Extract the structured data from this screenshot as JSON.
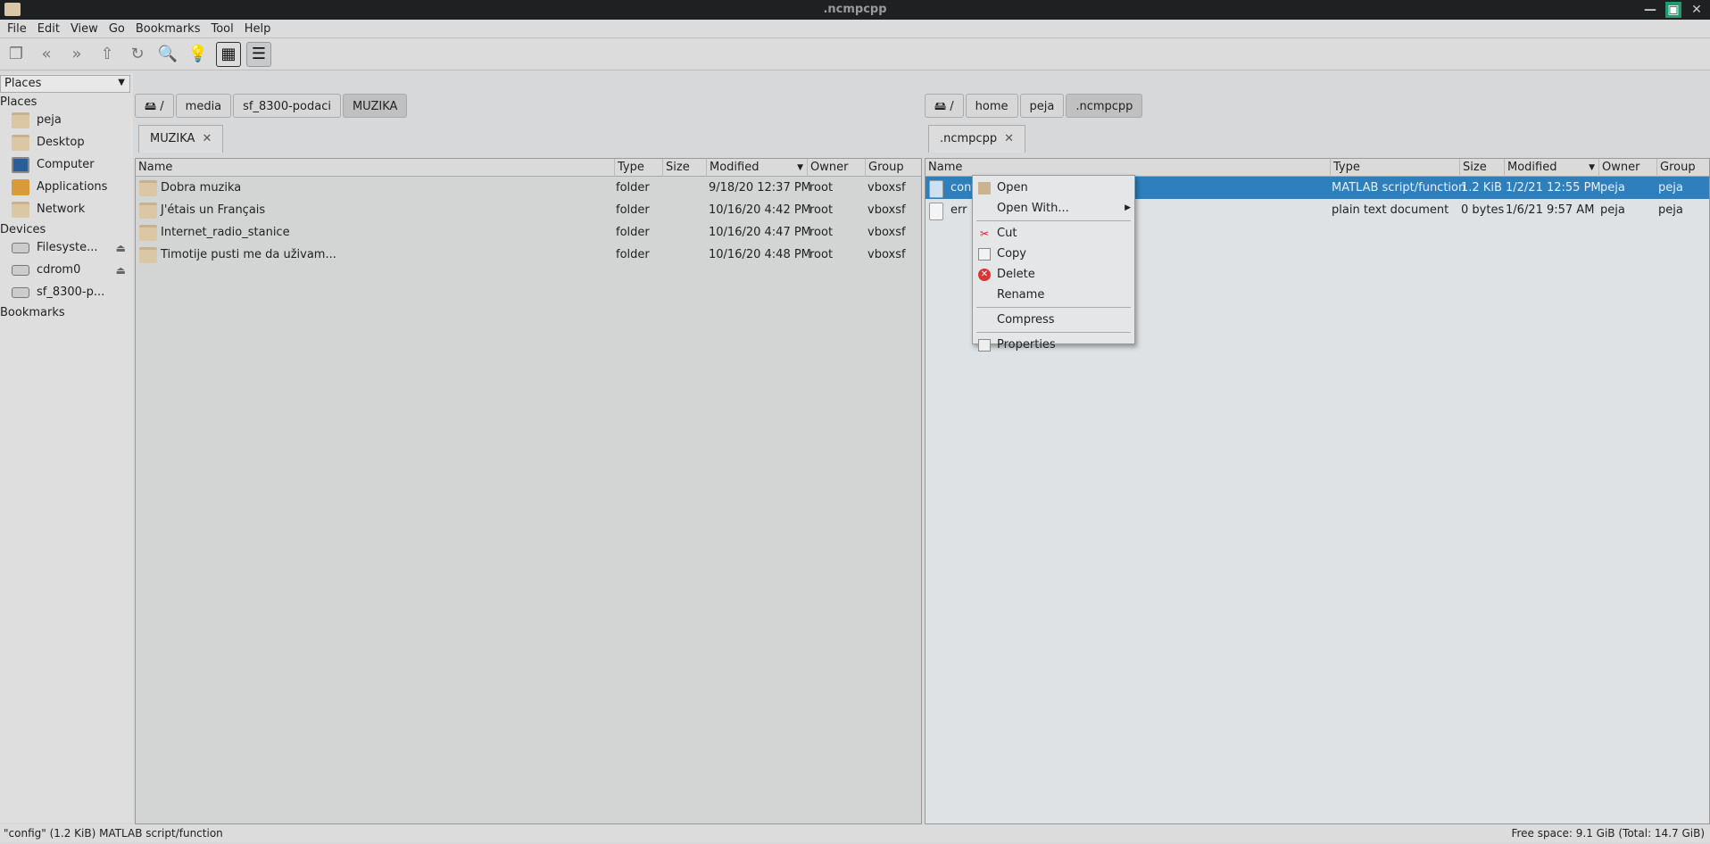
{
  "window": {
    "title": ".ncmpcpp"
  },
  "menu": [
    "File",
    "Edit",
    "View",
    "Go",
    "Bookmarks",
    "Tool",
    "Help"
  ],
  "toolbar": [
    "new-tab-icon",
    "back-icon",
    "forward-icon",
    "up-icon",
    "reload-icon",
    "find-icon",
    "lightbulb-icon",
    "icon-view-icon",
    "detail-view-icon"
  ],
  "sidebar": {
    "selector": "Places",
    "places_label": "Places",
    "places": [
      "peja",
      "Desktop",
      "Computer",
      "Applications",
      "Network"
    ],
    "devices_label": "Devices",
    "devices": [
      "Filesyste...",
      "cdrom0",
      "sf_8300-p..."
    ],
    "bookmarks_label": "Bookmarks"
  },
  "left": {
    "path": [
      "/",
      "media",
      "sf_8300-podaci",
      "MUZIKA"
    ],
    "tab": "MUZIKA",
    "columns": [
      "Name",
      "Type",
      "Size",
      "Modified",
      "Owner",
      "Group"
    ],
    "rows": [
      {
        "name": "Dobra muzika",
        "type": "folder",
        "size": "",
        "modified": "9/18/20 12:37 PM",
        "owner": "root",
        "group": "vboxsf"
      },
      {
        "name": "J'étais un Français",
        "type": "folder",
        "size": "",
        "modified": "10/16/20 4:42 PM",
        "owner": "root",
        "group": "vboxsf"
      },
      {
        "name": "Internet_radio_stanice",
        "type": "folder",
        "size": "",
        "modified": "10/16/20 4:47 PM",
        "owner": "root",
        "group": "vboxsf"
      },
      {
        "name": "Timotije pusti me da uživam...",
        "type": "folder",
        "size": "",
        "modified": "10/16/20 4:48 PM",
        "owner": "root",
        "group": "vboxsf"
      }
    ]
  },
  "right": {
    "path": [
      "/",
      "home",
      "peja",
      ".ncmpcpp"
    ],
    "tab": ".ncmpcpp",
    "columns": [
      "Name",
      "Type",
      "Size",
      "Modified",
      "Owner",
      "Group"
    ],
    "rows": [
      {
        "name": "config",
        "type": "MATLAB script/function",
        "size": "1.2 KiB",
        "modified": "1/2/21 12:55 PM",
        "owner": "peja",
        "group": "peja"
      },
      {
        "name": "err",
        "type": "plain text document",
        "size": "0 bytes",
        "modified": "1/6/21 9:57 AM",
        "owner": "peja",
        "group": "peja"
      }
    ]
  },
  "context_menu": [
    "Open",
    "Open With...",
    "Cut",
    "Copy",
    "Delete",
    "Rename",
    "Compress",
    "Properties"
  ],
  "status": {
    "left": "\"config\" (1.2 KiB) MATLAB script/function",
    "right": "Free space: 9.1 GiB (Total: 14.7 GiB)"
  },
  "colors": {
    "selection": "#2e7fbb",
    "titlebar": "#1f2022",
    "maximize": "#1e9a6e"
  }
}
